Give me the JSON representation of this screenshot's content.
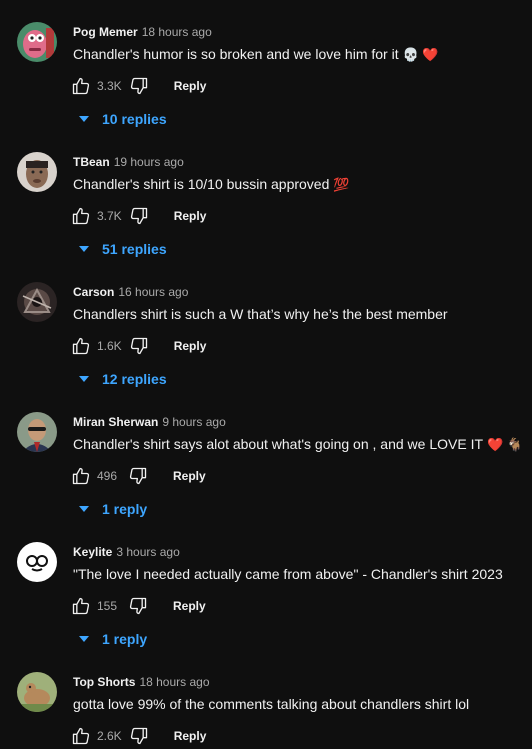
{
  "comments": [
    {
      "author": "Pog Memer",
      "time": "18 hours ago",
      "text": "Chandler's humor is so broken and we love him for it",
      "emoji": "💀 ❤️",
      "likes": "3.3K",
      "reply_label": "Reply",
      "replies": "10 replies",
      "avatar_color": "#c0392b"
    },
    {
      "author": "TBean",
      "time": "19 hours ago",
      "text": "Chandler's shirt is 10/10 bussin approved",
      "emoji": "💯",
      "likes": "3.7K",
      "reply_label": "Reply",
      "replies": "51 replies",
      "avatar_color": "#9e8a78"
    },
    {
      "author": "Carson",
      "time": "16 hours ago",
      "text": "Chandlers shirt is such a W that’s why he’s the best member",
      "emoji": "",
      "likes": "1.6K",
      "reply_label": "Reply",
      "replies": "12 replies",
      "avatar_color": "#3a2c2c"
    },
    {
      "author": "Miran Sherwan",
      "time": "9 hours ago",
      "text": "Chandler's shirt says alot about what's going on , and we LOVE IT",
      "emoji": "❤️ 🐐",
      "likes": "496",
      "reply_label": "Reply",
      "replies": "1 reply",
      "avatar_color": "#6b7a6a"
    },
    {
      "author": "Keylite",
      "time": "3 hours ago",
      "text": "\"The love I needed actually came from above\" - Chandler's shirt 2023",
      "emoji": "",
      "likes": "155",
      "reply_label": "Reply",
      "replies": "1 reply",
      "avatar_color": "#ffffff"
    },
    {
      "author": "Top Shorts",
      "time": "18 hours ago",
      "text": "gotta love 99% of the comments talking about chandlers shirt lol",
      "emoji": "",
      "likes": "2.6K",
      "reply_label": "Reply",
      "replies": "",
      "avatar_color": "#8fa36a"
    }
  ],
  "colors": {
    "background": "#0f0f0f",
    "text": "#f1f1f1",
    "secondary_text": "#aaaaaa",
    "link": "#3ea6ff"
  }
}
